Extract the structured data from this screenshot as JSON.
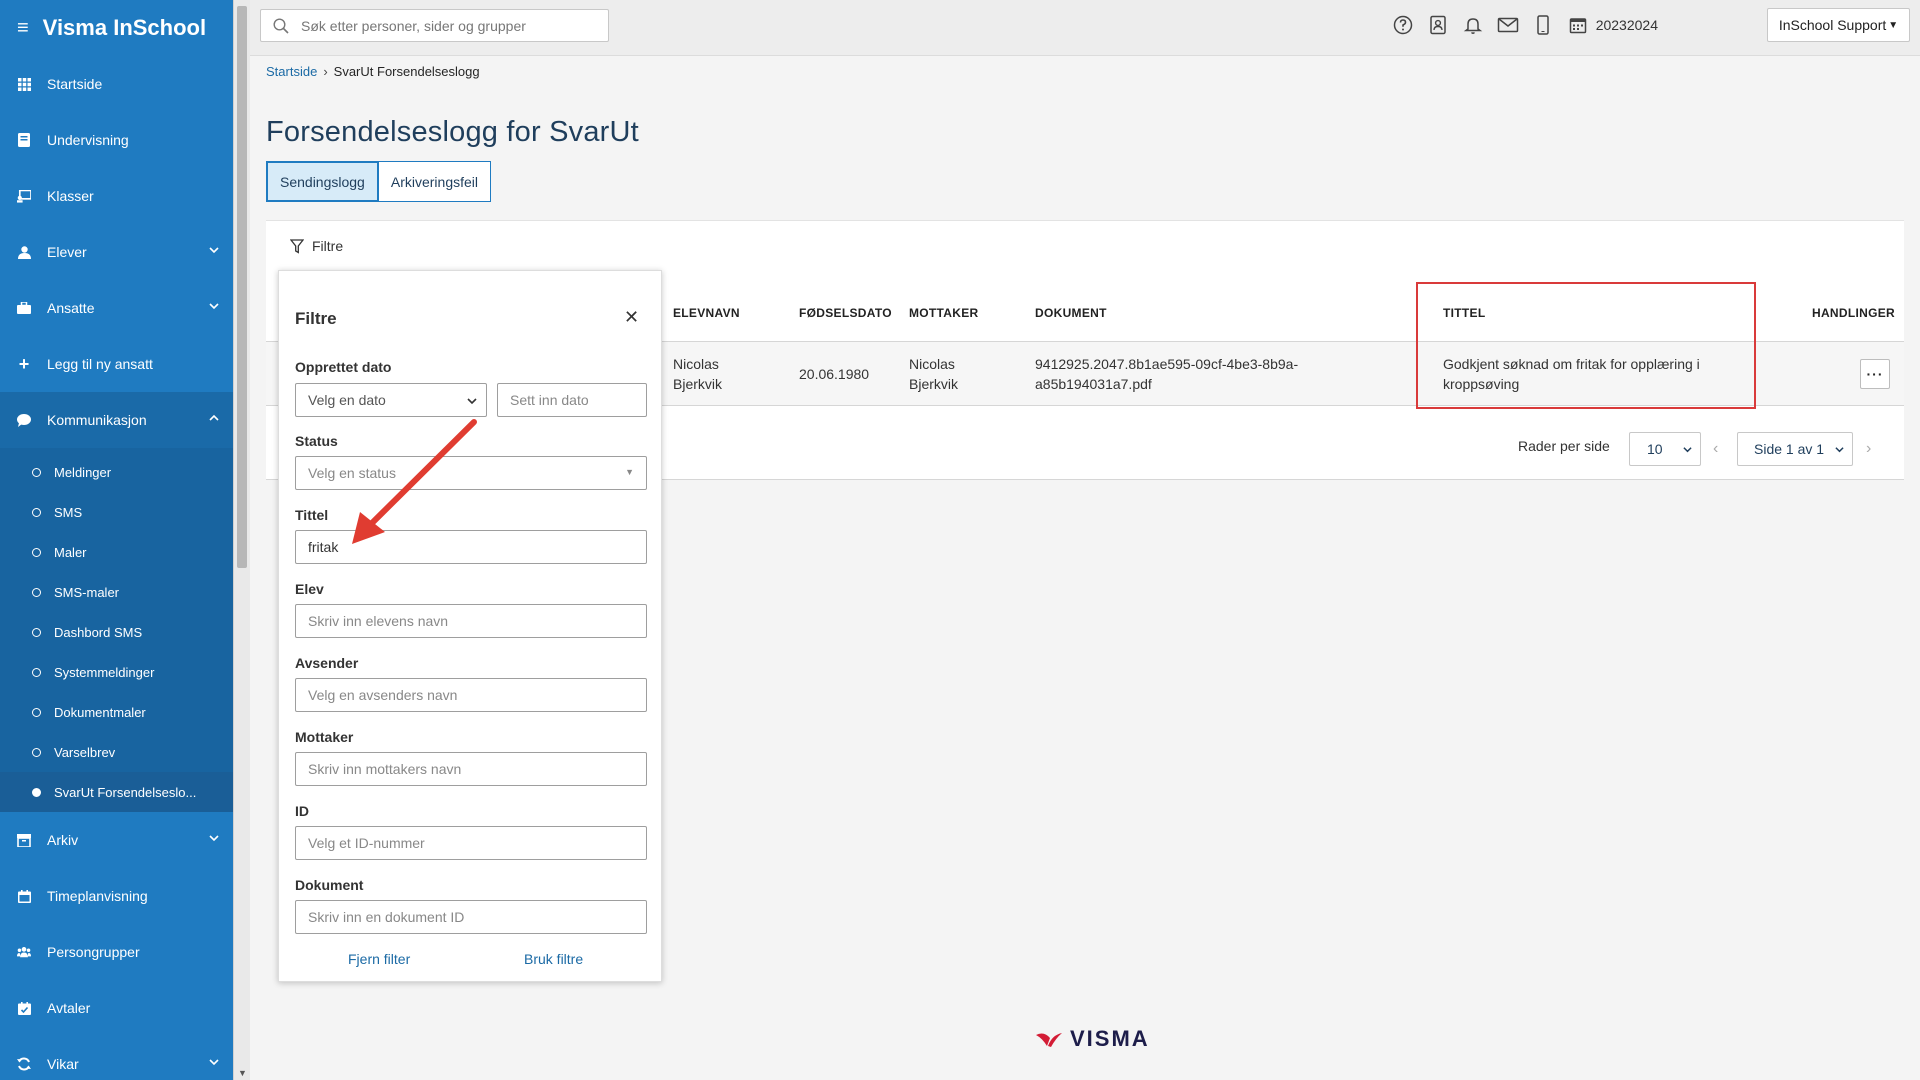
{
  "sidebar": {
    "brand": "Visma InSchool",
    "items": [
      {
        "label": "Startside"
      },
      {
        "label": "Undervisning"
      },
      {
        "label": "Klasser"
      },
      {
        "label": "Elever"
      },
      {
        "label": "Ansatte"
      },
      {
        "label": "Legg til ny ansatt"
      },
      {
        "label": "Kommunikasjon"
      },
      {
        "label": "Arkiv"
      },
      {
        "label": "Timeplanvisning"
      },
      {
        "label": "Persongrupper"
      },
      {
        "label": "Avtaler"
      },
      {
        "label": "Vikar"
      }
    ],
    "subitems": [
      {
        "label": "Meldinger"
      },
      {
        "label": "SMS"
      },
      {
        "label": "Maler"
      },
      {
        "label": "SMS-maler"
      },
      {
        "label": "Dashbord SMS"
      },
      {
        "label": "Systemmeldinger"
      },
      {
        "label": "Dokumentmaler"
      },
      {
        "label": "Varselbrev"
      },
      {
        "label": "SvarUt Forsendelseslo..."
      }
    ]
  },
  "topbar": {
    "search_placeholder": "Søk etter personer, sider og grupper",
    "year": "20232024",
    "user": "InSchool Support"
  },
  "breadcrumb": {
    "home": "Startside",
    "current": "SvarUt Forsendelseslogg"
  },
  "page": {
    "title": "Forsendelseslogg for SvarUt",
    "tabs": [
      "Sendingslogg",
      "Arkiveringsfeil"
    ]
  },
  "filter_toggle": "Filtre",
  "table": {
    "headers": [
      "ELEVNAVN",
      "FØDSELSDATO",
      "MOTTAKER",
      "DOKUMENT",
      "TITTEL",
      "HANDLINGER"
    ],
    "rows": [
      {
        "elevnavn": [
          "Nicolas",
          "Bjerkvik"
        ],
        "fodselsdato": "20.06.1980",
        "mottaker": [
          "Nicolas",
          "Bjerkvik"
        ],
        "dokument": [
          "9412925.2047.8b1ae595-09cf-4be3-8b9a-",
          "a85b194031a7.pdf"
        ],
        "tittel": [
          "Godkjent søknad om fritak for opplæring i",
          "kroppsøving"
        ]
      }
    ]
  },
  "pagination": {
    "rows_label": "Rader per side",
    "rows_value": "10",
    "page_label": "Side 1 av 1"
  },
  "filter_panel": {
    "title": "Filtre",
    "date_label": "Opprettet dato",
    "date_select": "Velg en dato",
    "date_input_placeholder": "Sett inn dato",
    "status_label": "Status",
    "status_placeholder": "Velg en status",
    "title_label": "Tittel",
    "title_value": "fritak",
    "student_label": "Elev",
    "student_placeholder": "Skriv inn elevens navn",
    "sender_label": "Avsender",
    "sender_placeholder": "Velg en avsenders navn",
    "recipient_label": "Mottaker",
    "recipient_placeholder": "Skriv inn mottakers navn",
    "id_label": "ID",
    "id_placeholder": "Velg et ID-nummer",
    "document_label": "Dokument",
    "document_placeholder": "Skriv inn en dokument ID",
    "clear_label": "Fjern filter",
    "apply_label": "Bruk filtre"
  },
  "footer": {
    "logo_text": "VISMA"
  },
  "colors": {
    "sidebar": "#1f7bc1",
    "accent": "#1b6aa5",
    "highlight": "#d93a3a",
    "title": "#1f3e5c"
  }
}
